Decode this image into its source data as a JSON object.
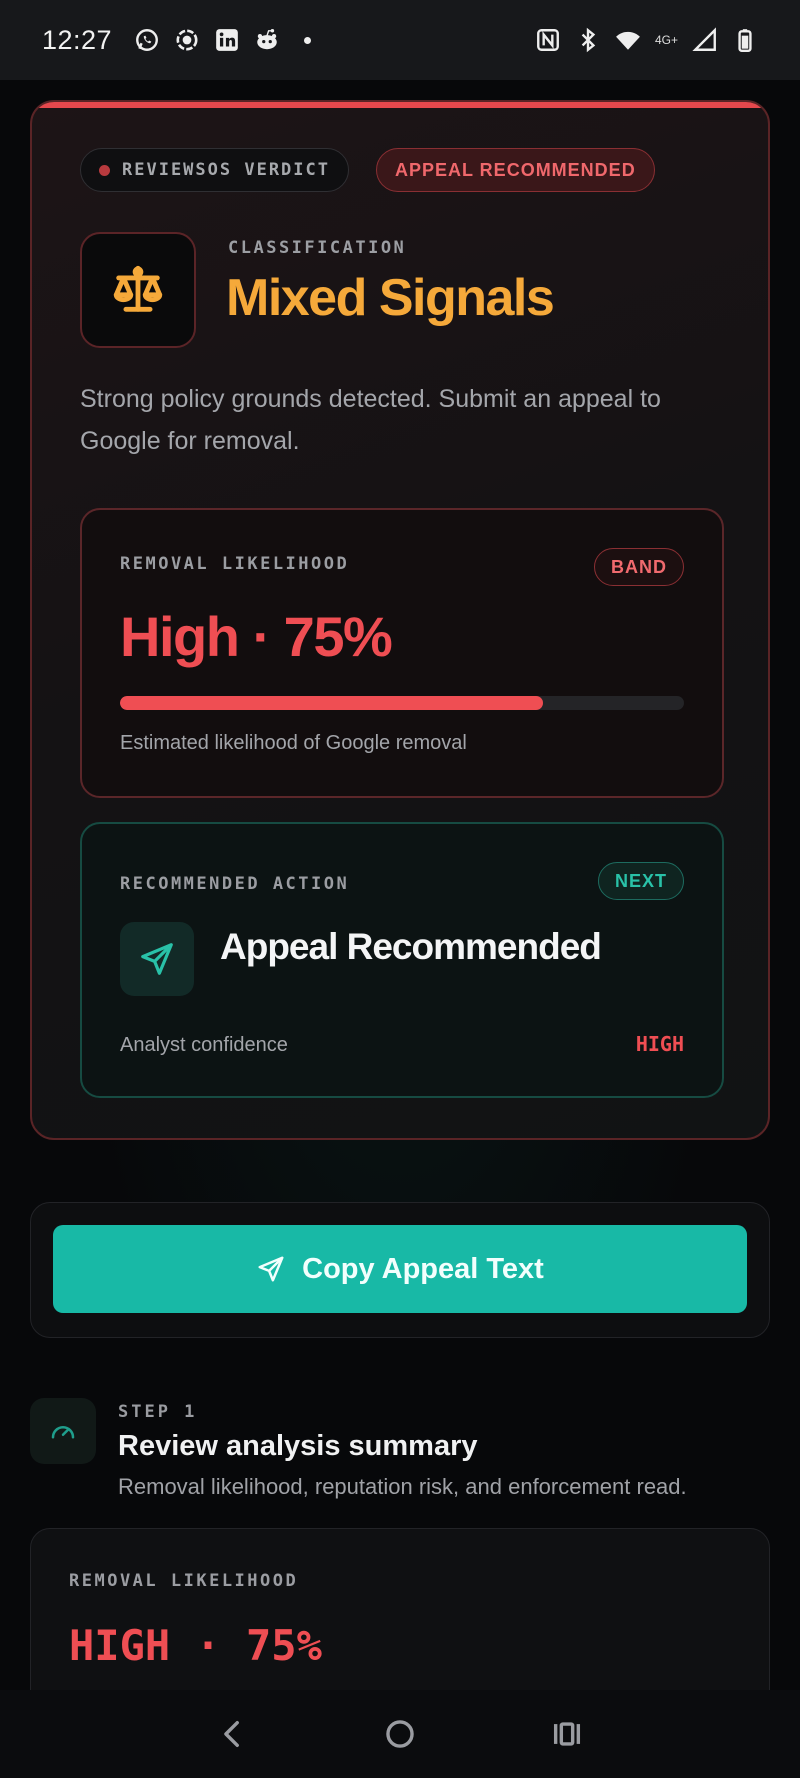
{
  "status_bar": {
    "time": "12:27",
    "notification_icons": [
      "whatsapp-icon",
      "screen-record-icon",
      "linkedin-icon",
      "reddit-icon",
      "dot-icon"
    ],
    "network_label": "4G+",
    "system_icons": [
      "nfc-icon",
      "bluetooth-icon",
      "wifi-icon",
      "signal-icon",
      "battery-icon"
    ]
  },
  "verdict": {
    "chip_label": "REVIEWSOS VERDICT",
    "status_chip": "APPEAL RECOMMENDED",
    "classification_label": "CLASSIFICATION",
    "classification": "Mixed Signals",
    "description": "Strong policy grounds detected. Submit an appeal to Google for removal.",
    "icon": "scale-icon",
    "removal": {
      "label": "REMOVAL LIKELIHOOD",
      "badge": "BAND",
      "value": "High · 75%",
      "percent": 75,
      "note": "Estimated likelihood of Google removal"
    },
    "action": {
      "label": "RECOMMENDED ACTION",
      "badge": "NEXT",
      "icon": "send-icon",
      "title": "Appeal Recommended",
      "confidence_label": "Analyst confidence",
      "confidence_value": "HIGH"
    }
  },
  "copy_button": {
    "label": "Copy Appeal Text",
    "icon": "send-icon"
  },
  "step": {
    "label": "STEP 1",
    "title": "Review analysis summary",
    "subtitle": "Removal likelihood, reputation risk, and enforcement read.",
    "icon": "gauge-icon"
  },
  "summary": {
    "label": "REMOVAL LIKELIHOOD",
    "value": "HIGH · 75%"
  },
  "nav": {
    "icons": [
      "back-icon",
      "home-icon",
      "recents-icon"
    ]
  },
  "colors": {
    "accent_red": "#ef4e53",
    "accent_orange": "#f5a93a",
    "accent_teal": "#18b9a6",
    "background": "#07080a"
  }
}
